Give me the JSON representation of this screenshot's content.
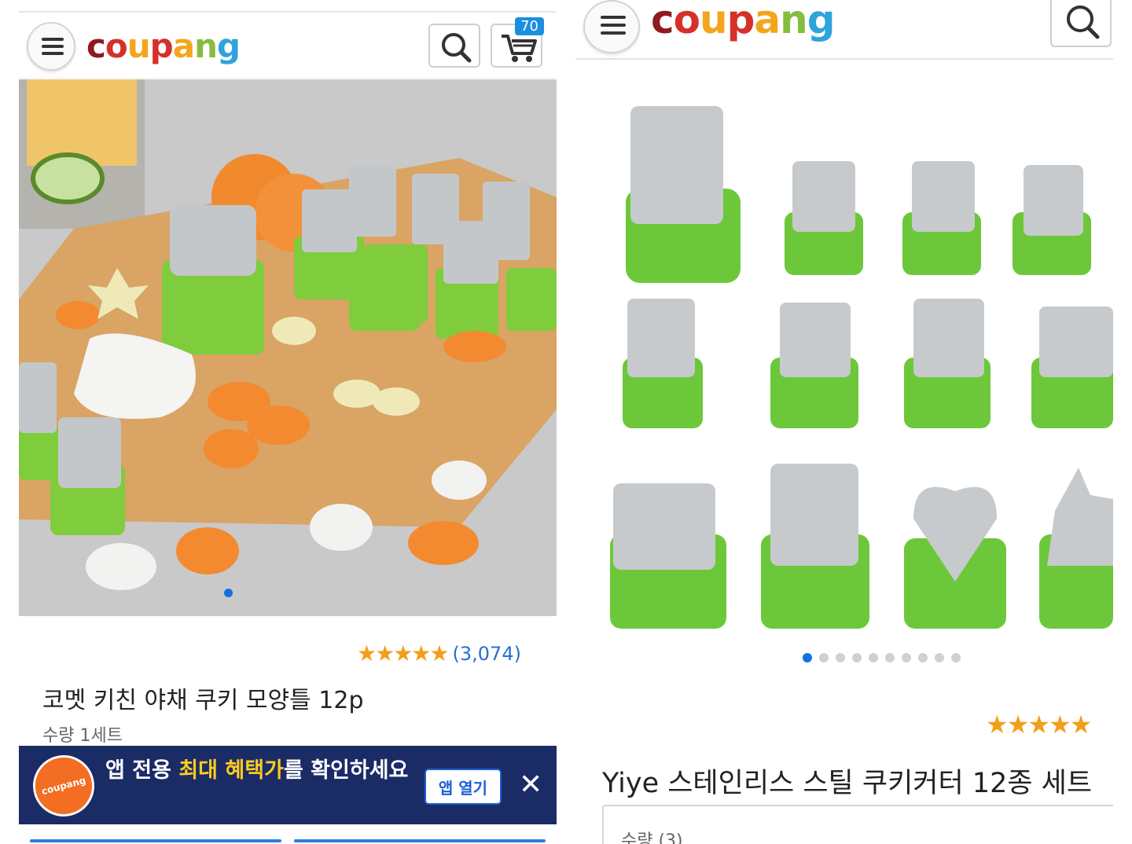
{
  "left": {
    "logo_text": "coupang",
    "cart_count": "70",
    "rating_stars": "★★★★★",
    "rating_count": "(3,074)",
    "title": "코멧 키친 야채 쿠키 모양틀 12p",
    "quantity": "수량 1세트",
    "banner": {
      "logo_text": "coupang",
      "text_before": "앱 전용 ",
      "text_highlight": "최대 혜택가",
      "text_after": "를 확인하세요",
      "open_button": "앱 열기",
      "close_glyph": "✕"
    },
    "carousel": {
      "count": 1,
      "active": 0
    }
  },
  "right": {
    "logo_text": "coupang",
    "rating_stars": "★★★★★",
    "title": "Yiye 스테인리스 스틸 쿠키커터 12종 세트",
    "quantity": "수량 (3)",
    "carousel": {
      "count": 10,
      "active": 0
    }
  },
  "colors": {
    "brand_blue": "#1a2b66",
    "accent_blue": "#1371e0",
    "star_orange": "#f39e1b",
    "cutter_green": "#6cc83a",
    "highlight_yellow": "#ffcb1f"
  },
  "icons": [
    "menu-icon",
    "search-icon",
    "cart-icon",
    "close-icon"
  ]
}
